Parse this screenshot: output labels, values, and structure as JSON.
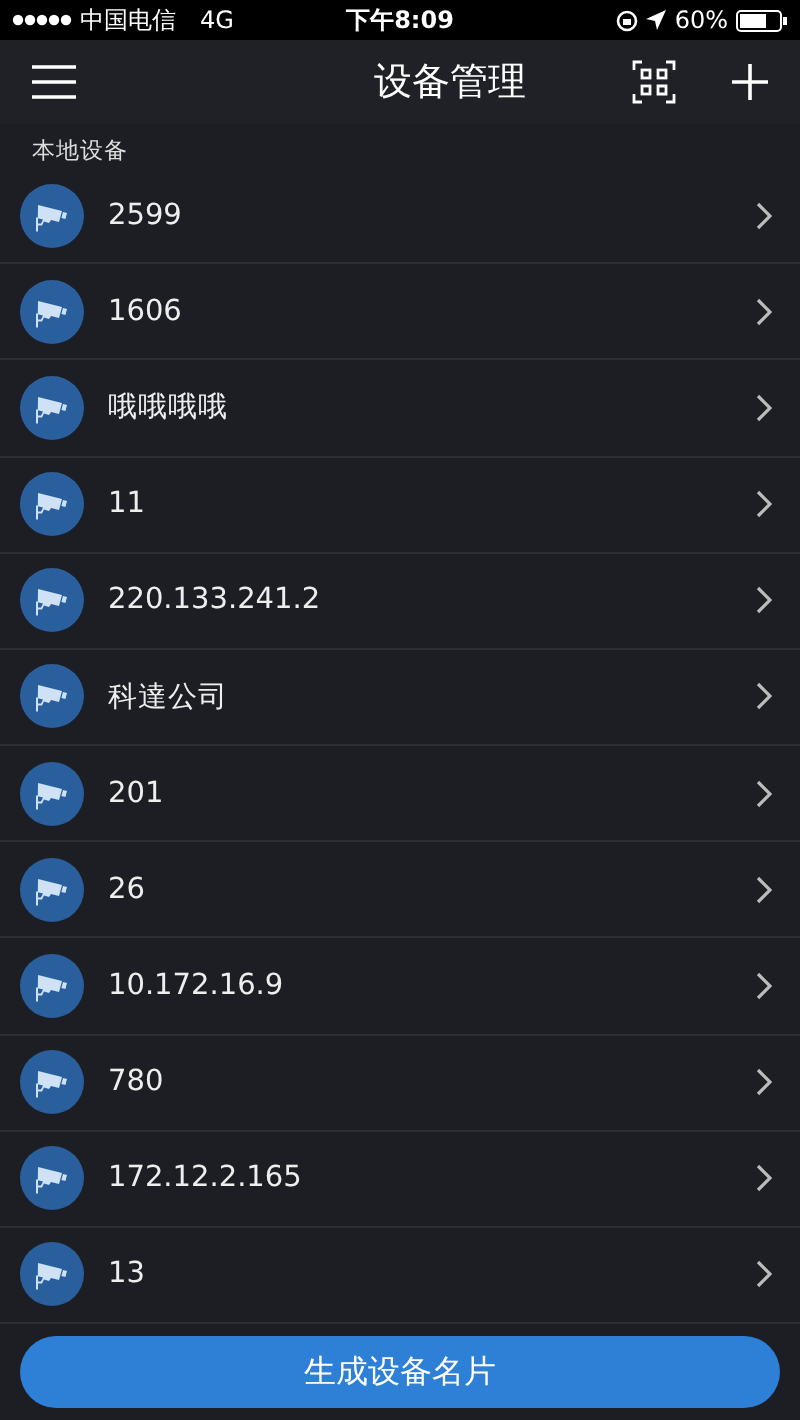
{
  "status_bar": {
    "carrier": "中国电信",
    "network": "4G",
    "time": "下午8:09",
    "battery": "60%"
  },
  "header": {
    "title": "设备管理"
  },
  "section": {
    "title": "本地设备"
  },
  "devices": [
    {
      "name": "2599"
    },
    {
      "name": "1606"
    },
    {
      "name": "哦哦哦哦"
    },
    {
      "name": "11"
    },
    {
      "name": "220.133.241.2"
    },
    {
      "name": "科達公司"
    },
    {
      "name": "201"
    },
    {
      "name": "26"
    },
    {
      "name": "10.172.16.9"
    },
    {
      "name": "780"
    },
    {
      "name": "172.12.2.165"
    },
    {
      "name": "13"
    }
  ],
  "action_button": {
    "label": "生成设备名片"
  }
}
